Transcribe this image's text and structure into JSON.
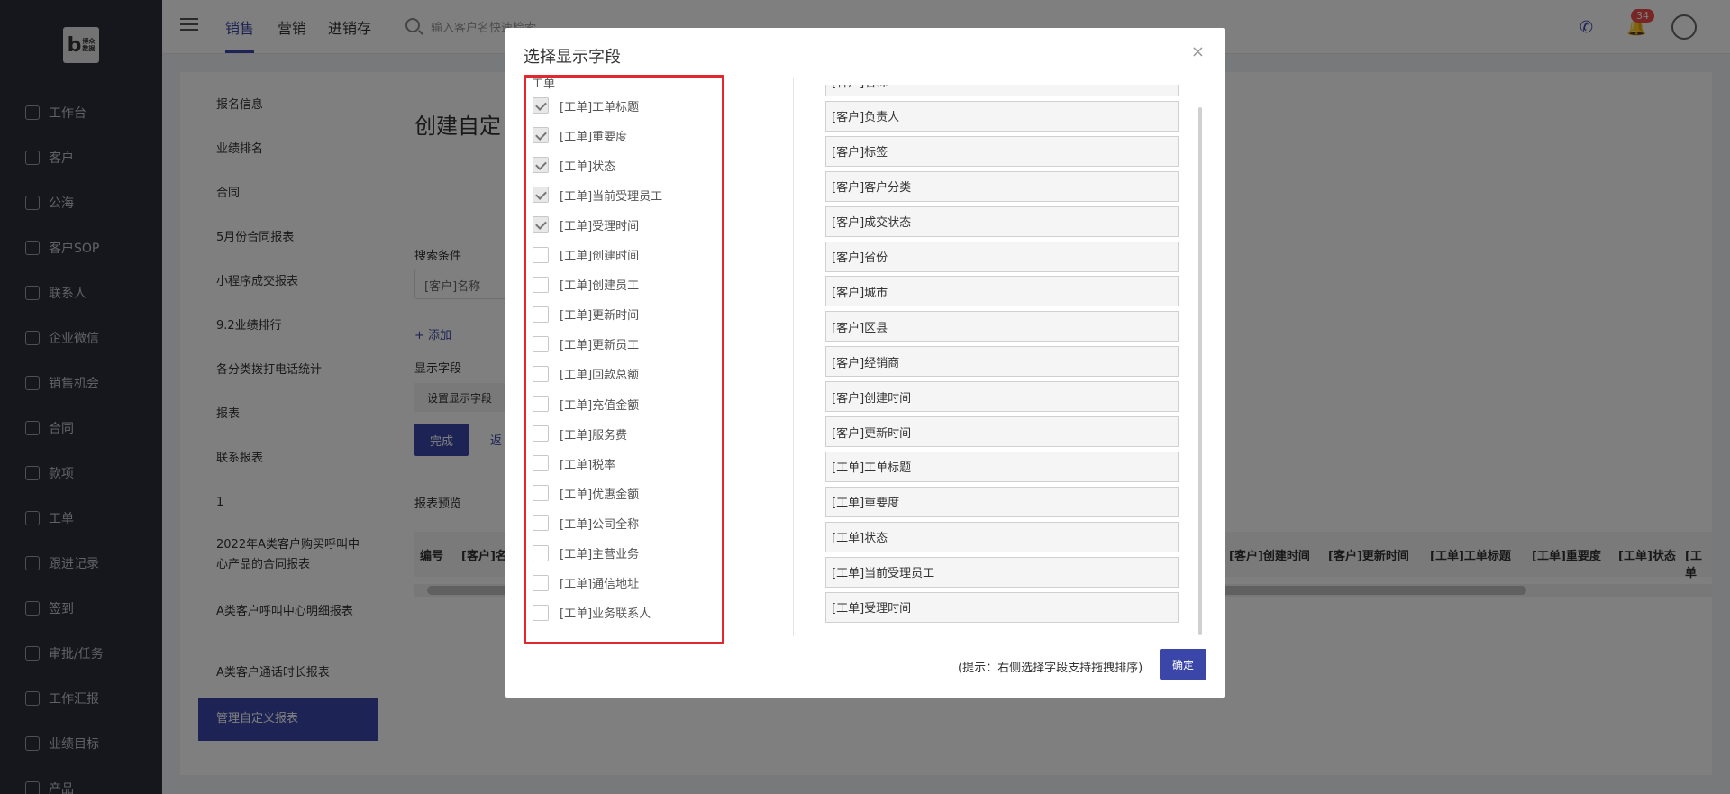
{
  "sidebar": {
    "logo_letter": "b",
    "logo_text_1": "博众",
    "logo_text_2": "数据",
    "items": [
      {
        "label": "工作台"
      },
      {
        "label": "客户"
      },
      {
        "label": "公海"
      },
      {
        "label": "客户SOP"
      },
      {
        "label": "联系人"
      },
      {
        "label": "企业微信"
      },
      {
        "label": "销售机会"
      },
      {
        "label": "合同"
      },
      {
        "label": "款项"
      },
      {
        "label": "工单"
      },
      {
        "label": "跟进记录"
      },
      {
        "label": "签到"
      },
      {
        "label": "审批/任务"
      },
      {
        "label": "工作汇报"
      },
      {
        "label": "业绩目标"
      },
      {
        "label": "产品"
      }
    ]
  },
  "topbar": {
    "tabs": [
      {
        "label": "销售"
      },
      {
        "label": "营销"
      },
      {
        "label": "进销存"
      }
    ],
    "search_placeholder": "输入客户名快速检索",
    "notification_count": "34",
    "phone_icon": "phone-icon",
    "bell_icon": "bell-icon"
  },
  "reports": {
    "items": [
      {
        "label": "报名信息"
      },
      {
        "label": "业绩排名"
      },
      {
        "label": "合同"
      },
      {
        "label": "5月份合同报表"
      },
      {
        "label": "小程序成交报表"
      },
      {
        "label": "9.2业绩排行"
      },
      {
        "label": "各分类拨打电话统计"
      },
      {
        "label": "报表"
      },
      {
        "label": "联系报表"
      },
      {
        "label": "1"
      },
      {
        "label": "2022年A类客户购买呼叫中心产品的合同报表"
      },
      {
        "label": "A类客户呼叫中心明细报表"
      },
      {
        "label": "A类客户通话时长报表"
      },
      {
        "label": "管理自定义报表"
      }
    ]
  },
  "main": {
    "title": "创建自定",
    "search_conditions_label": "搜索条件",
    "search_field_value": "[客户]名称",
    "add_link": "+ 添加",
    "display_fields_label": "显示字段",
    "set_fields_button": "设置显示字段",
    "done_button": "完成",
    "back_link": "返",
    "preview_label": "报表预览",
    "preview_columns_left": [
      "编号",
      "[客户]名"
    ],
    "preview_columns_right": [
      "[客户]创建时间",
      "[客户]更新时间",
      "[工单]工单标题",
      "[工单]重要度",
      "[工单]状态",
      "[工单"
    ]
  },
  "modal": {
    "title": "选择显示字段",
    "close": "×",
    "group_label": "工单",
    "checkboxes": [
      {
        "label": "[工单]工单标题",
        "checked": true
      },
      {
        "label": "[工单]重要度",
        "checked": true
      },
      {
        "label": "[工单]状态",
        "checked": true
      },
      {
        "label": "[工单]当前受理员工",
        "checked": true
      },
      {
        "label": "[工单]受理时间",
        "checked": true
      },
      {
        "label": "[工单]创建时间",
        "checked": false
      },
      {
        "label": "[工单]创建员工",
        "checked": false
      },
      {
        "label": "[工单]更新时间",
        "checked": false
      },
      {
        "label": "[工单]更新员工",
        "checked": false
      },
      {
        "label": "[工单]回款总额",
        "checked": false
      },
      {
        "label": "[工单]充值金额",
        "checked": false
      },
      {
        "label": "[工单]服务费",
        "checked": false
      },
      {
        "label": "[工单]税率",
        "checked": false
      },
      {
        "label": "[工单]优惠金额",
        "checked": false
      },
      {
        "label": "[工单]公司全称",
        "checked": false
      },
      {
        "label": "[工单]主营业务",
        "checked": false
      },
      {
        "label": "[工单]通信地址",
        "checked": false
      },
      {
        "label": "[工单]业务联系人",
        "checked": false
      }
    ],
    "selected_fields": [
      {
        "label": "[客户]名称"
      },
      {
        "label": "[客户]负责人"
      },
      {
        "label": "[客户]标签"
      },
      {
        "label": "[客户]客户分类"
      },
      {
        "label": "[客户]成交状态"
      },
      {
        "label": "[客户]省份"
      },
      {
        "label": "[客户]城市"
      },
      {
        "label": "[客户]区县"
      },
      {
        "label": "[客户]经销商"
      },
      {
        "label": "[客户]创建时间"
      },
      {
        "label": "[客户]更新时间"
      },
      {
        "label": "[工单]工单标题"
      },
      {
        "label": "[工单]重要度"
      },
      {
        "label": "[工单]状态"
      },
      {
        "label": "[工单]当前受理员工"
      },
      {
        "label": "[工单]受理时间"
      }
    ],
    "hint": "(提示：右侧选择字段支持拖拽排序)",
    "ok_button": "确定"
  }
}
